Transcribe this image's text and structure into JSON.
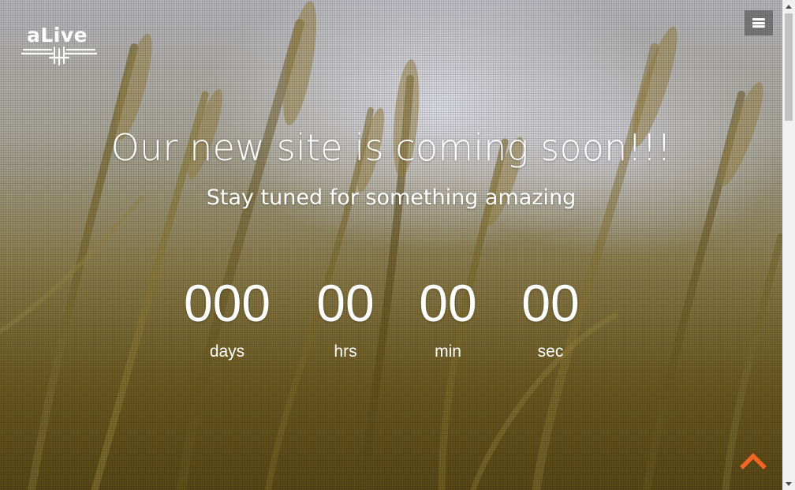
{
  "brand": {
    "logo_text": "aLive"
  },
  "hero": {
    "headline": "Our new site is coming soon!!!",
    "subline": "Stay tuned for something amazing"
  },
  "countdown": {
    "days": {
      "value": "000",
      "label": "days"
    },
    "hrs": {
      "value": "00",
      "label": "hrs"
    },
    "min": {
      "value": "00",
      "label": "min"
    },
    "sec": {
      "value": "00",
      "label": "sec"
    }
  },
  "icons": {
    "menu": "hamburger-icon",
    "scroll_top": "chevron-up-icon"
  },
  "colors": {
    "accent": "#f26522",
    "text": "#ffffff",
    "menu_bg": "#464646"
  }
}
